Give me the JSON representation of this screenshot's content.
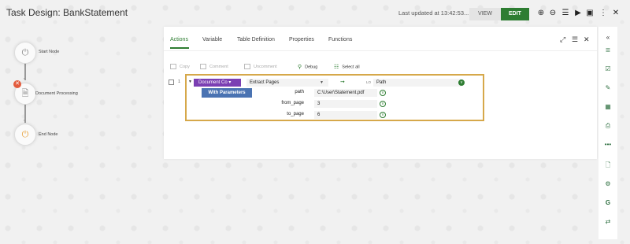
{
  "header": {
    "title": "Task Design: BankStatement",
    "updated": "Last updated at 13:42:53...",
    "view_label": "VIEW",
    "edit_label": "EDIT"
  },
  "flow": {
    "nodes": [
      {
        "label": "Start Node"
      },
      {
        "label": "Document Processing"
      },
      {
        "label": "End Node"
      }
    ]
  },
  "panel": {
    "tabs": [
      "Actions",
      "Variable",
      "Table Definition",
      "Properties",
      "Functions"
    ],
    "toolbar": {
      "copy": "Copy",
      "comment": "Comment",
      "uncomment": "Uncomment",
      "debug": "Debug",
      "select_all": "Select all"
    },
    "row": {
      "number": "1",
      "component": "Document Co",
      "action": "Extract Pages",
      "output_type": "LO",
      "output_var": "Path",
      "with_params_label": "With Parameters",
      "params": [
        {
          "name": "path",
          "value": "C:\\User\\Statement.pdf"
        },
        {
          "name": "from_page",
          "value": "3"
        },
        {
          "name": "to_page",
          "value": "6"
        }
      ]
    }
  },
  "colors": {
    "accent_green": "#2e7d32",
    "component_purple": "#7b3fb3",
    "params_blue": "#4a73b2",
    "highlight_gold": "#d6a84a"
  }
}
